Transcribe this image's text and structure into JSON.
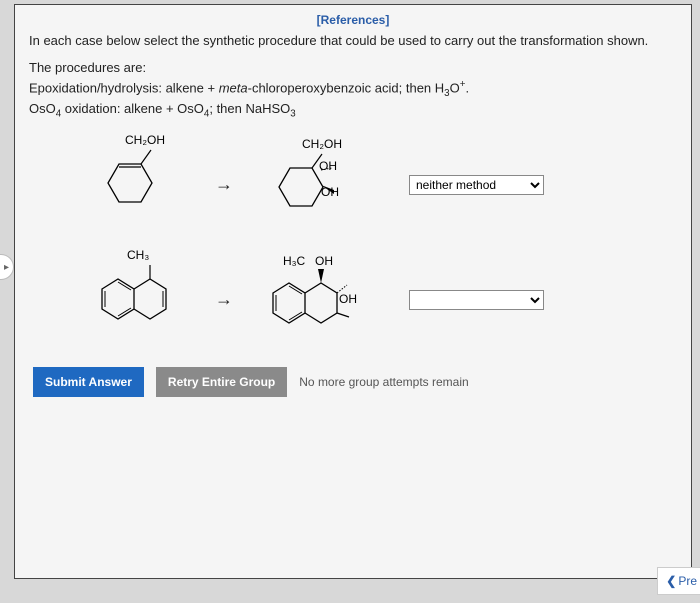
{
  "references_link": "[References]",
  "instruction": "In each case below select the synthetic procedure that could be used to carry out the transformation shown.",
  "procedures_heading": "The procedures are:",
  "procedure1_html": "Epoxidation/hydrolysis: alkene + <i>meta</i>-chloroperoxybenzoic acid; then H<span class='sub'>3</span>O<span class='sup'>+</span>.",
  "procedure2_html": "OsO<span class='sub'>4</span> oxidation: alkene + OsO<span class='sub'>4</span>; then NaHSO<span class='sub'>3</span>",
  "arrow": "→",
  "reaction1": {
    "start_label": "CH₂OH",
    "prod_label_top": "CH₂OH",
    "prod_label_mid": "OH",
    "prod_label_bot": "OH",
    "selected": "neither method"
  },
  "reaction2": {
    "start_label": "CH₃",
    "prod_label_ch3": "H₃C",
    "prod_label_oh1": "OH",
    "prod_label_oh2": "OH",
    "selected": ""
  },
  "select_options": [
    "",
    "Epoxidation/hydrolysis",
    "OsO4 oxidation",
    "neither method"
  ],
  "submit_label": "Submit Answer",
  "retry_label": "Retry Entire Group",
  "attempts_text": "No more group attempts remain",
  "prev_label": "Pre"
}
